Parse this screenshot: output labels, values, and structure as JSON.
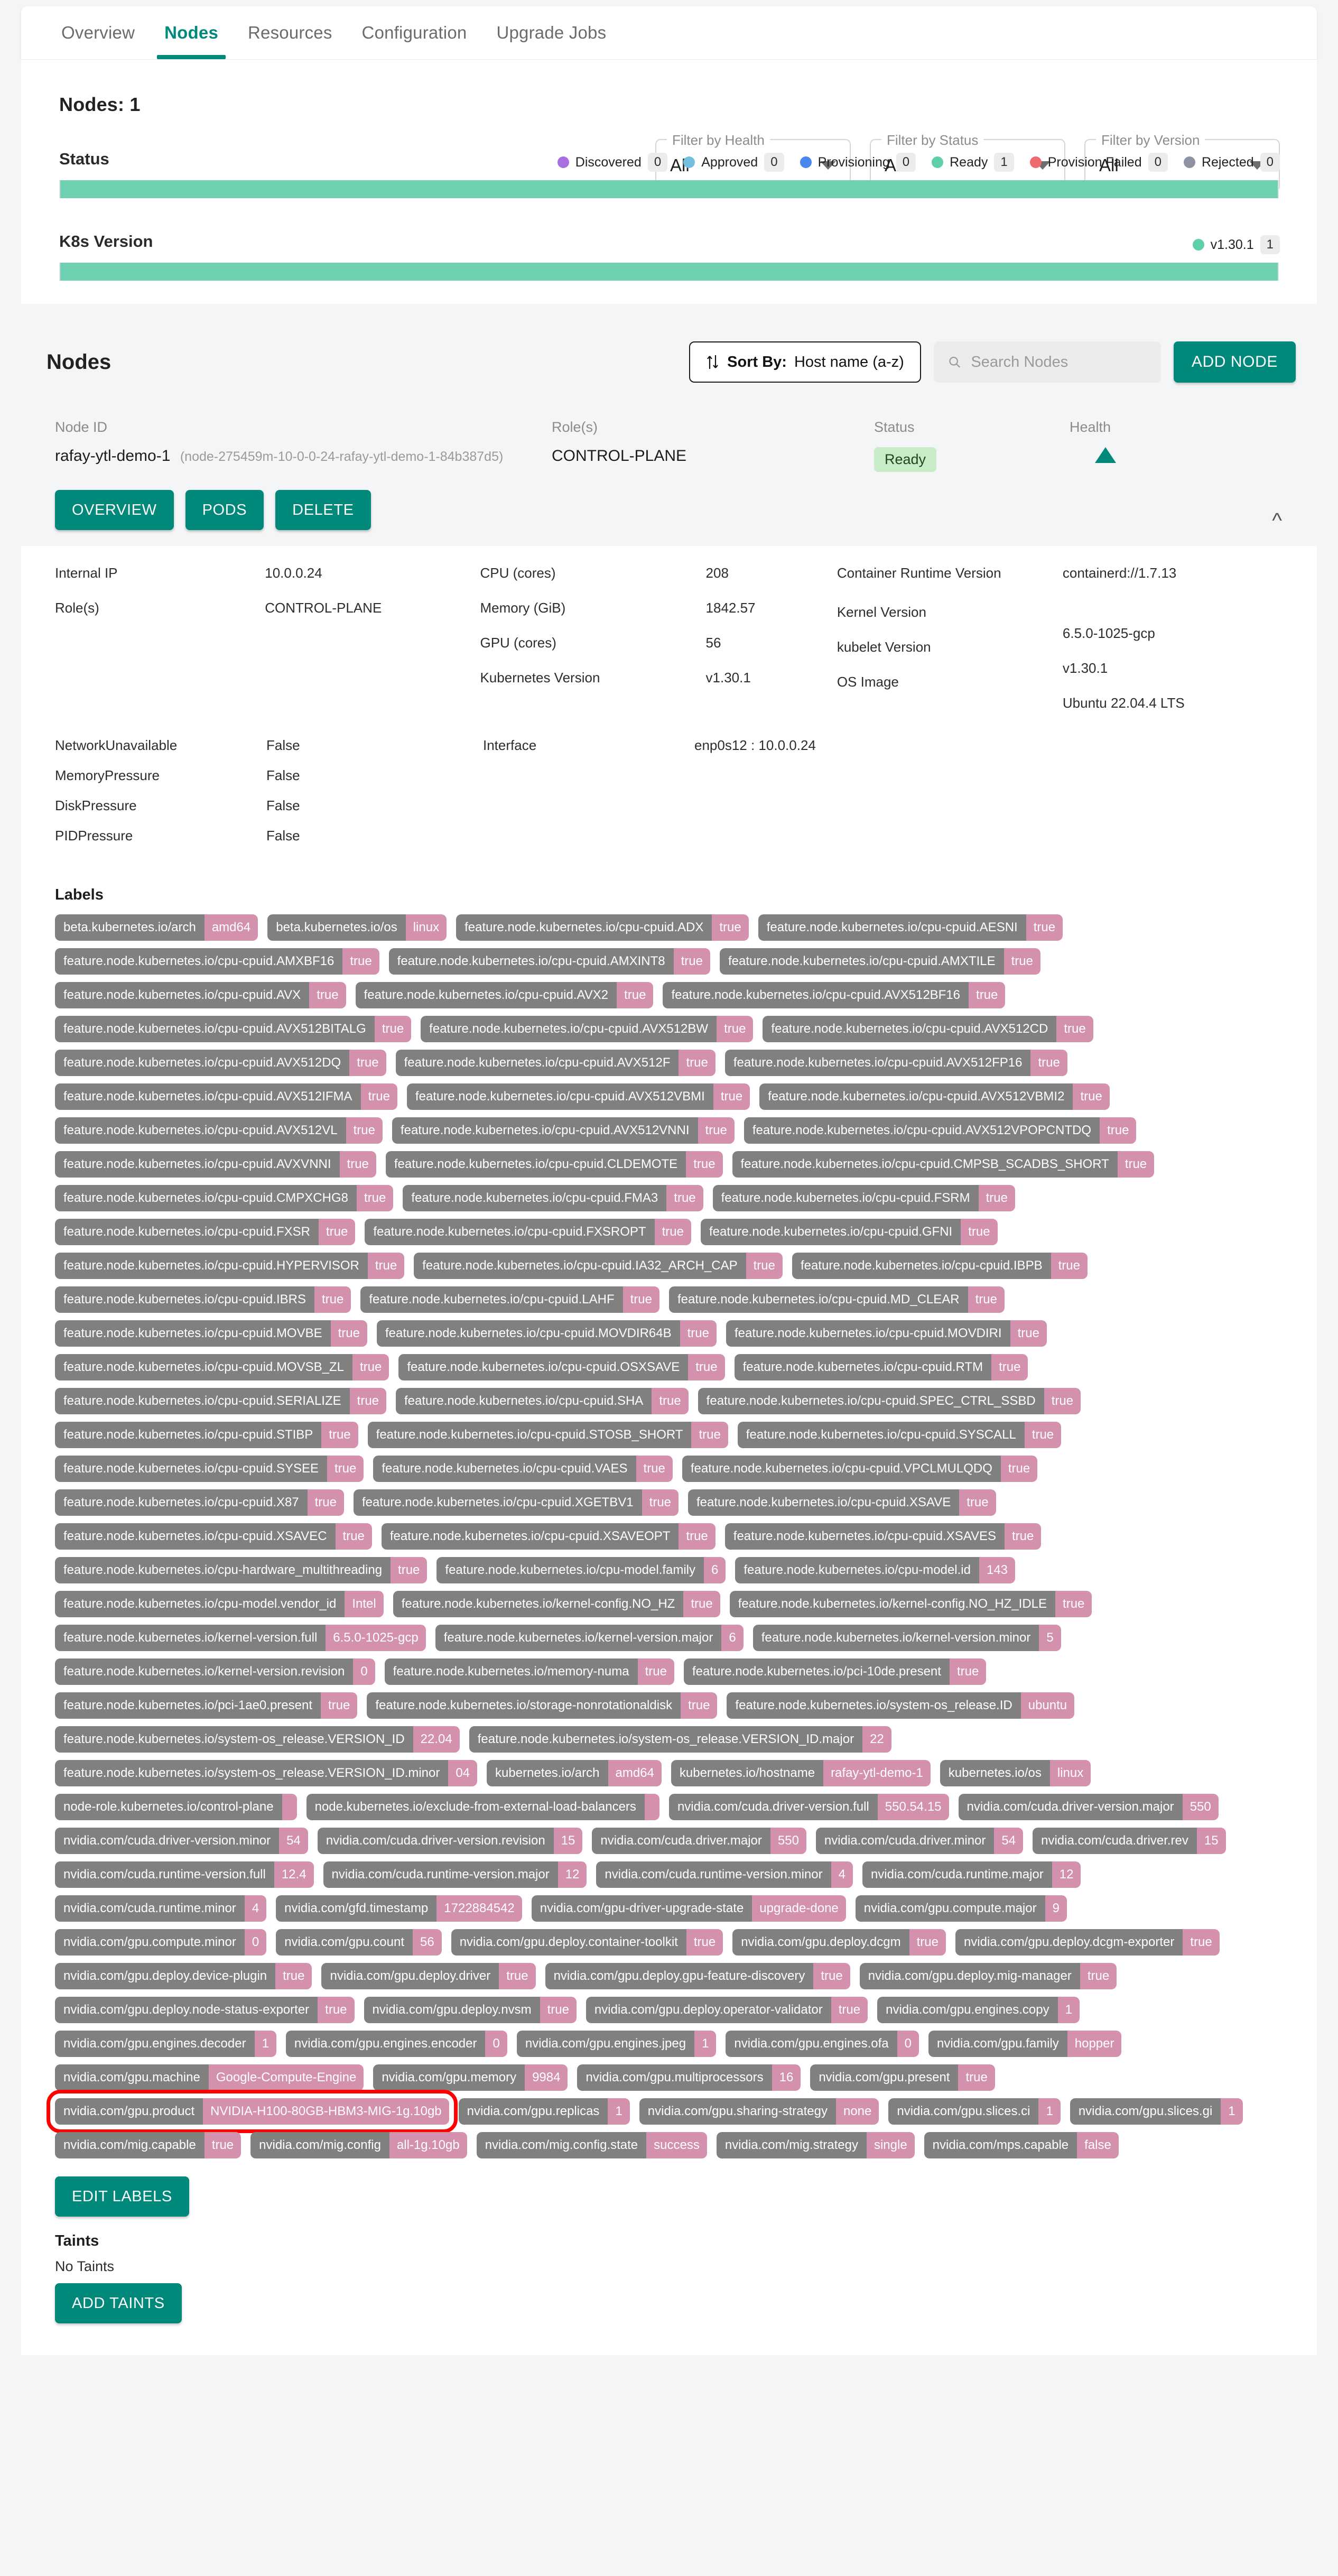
{
  "tabs": [
    {
      "label": "Overview",
      "active": false
    },
    {
      "label": "Nodes",
      "active": true
    },
    {
      "label": "Resources",
      "active": false
    },
    {
      "label": "Configuration",
      "active": false
    },
    {
      "label": "Upgrade Jobs",
      "active": false
    }
  ],
  "summary": {
    "nodes_count_label": "Nodes: 1",
    "filters": [
      {
        "legend": "Filter by Health",
        "value": "All"
      },
      {
        "legend": "Filter by Status",
        "value": "All"
      },
      {
        "legend": "Filter by Version",
        "value": "All"
      }
    ],
    "status": {
      "label": "Status",
      "legend": [
        {
          "name": "Discovered",
          "count": "0",
          "color": "#a96fe0"
        },
        {
          "name": "Approved",
          "count": "0",
          "color": "#74bede"
        },
        {
          "name": "Provisioning",
          "count": "0",
          "color": "#4a86ee"
        },
        {
          "name": "Ready",
          "count": "1",
          "color": "#5ecfa6"
        },
        {
          "name": "Provision Failed",
          "count": "0",
          "color": "#ef6b6b"
        },
        {
          "name": "Rejected",
          "count": "0",
          "color": "#8d93a3"
        }
      ],
      "bar_color": "#6ed0b0",
      "bar_percent": 100
    },
    "k8s_version": {
      "label": "K8s Version",
      "legend": [
        {
          "name": "v1.30.1",
          "count": "1",
          "color": "#5ecfa6"
        }
      ],
      "bar_color": "#6ed0b0",
      "bar_percent": 100
    }
  },
  "nodes_toolbar": {
    "title": "Nodes",
    "sort_icon": "sort-arrows-icon",
    "sort_prefix": "Sort By:",
    "sort_value": "Host name (a-z)",
    "search_icon": "search-icon",
    "search_placeholder": "Search Nodes",
    "search_value": "",
    "add_node_label": "ADD NODE"
  },
  "node": {
    "columns": {
      "node_id": "Node ID",
      "roles": "Role(s)",
      "status": "Status",
      "health": "Health"
    },
    "node_id_value": "rafay-ytl-demo-1",
    "node_id_sub": "(node-275459m-10-0-0-24-rafay-ytl-demo-1-84b387d5)",
    "roles_value": "CONTROL-PLANE",
    "status_value": "Ready",
    "health_icon": "triangle-up-icon",
    "collapse_icon": "chevron-up-icon",
    "actions": [
      {
        "label": "OVERVIEW"
      },
      {
        "label": "PODS"
      },
      {
        "label": "DELETE"
      }
    ],
    "info": {
      "col1": [
        {
          "key": "Internal IP",
          "value": "10.0.0.24"
        },
        {
          "key": "Role(s)",
          "value": "CONTROL-PLANE"
        }
      ],
      "col2": [
        {
          "key": "CPU (cores)",
          "value": "208"
        },
        {
          "key": "Memory (GiB)",
          "value": "1842.57"
        },
        {
          "key": "GPU (cores)",
          "value": "56"
        },
        {
          "key": "Kubernetes Version",
          "value": "v1.30.1"
        }
      ],
      "col3": [
        {
          "key": "Container Runtime Version",
          "value": "containerd://1.7.13"
        },
        {
          "key": "Kernel Version",
          "value": "6.5.0-1025-gcp"
        },
        {
          "key": "kubelet Version",
          "value": "v1.30.1"
        },
        {
          "key": "OS Image",
          "value": "Ubuntu 22.04.4 LTS"
        }
      ]
    },
    "conditions": [
      {
        "key": "NetworkUnavailable",
        "value": "False"
      },
      {
        "key": "MemoryPressure",
        "value": "False"
      },
      {
        "key": "DiskPressure",
        "value": "False"
      },
      {
        "key": "PIDPressure",
        "value": "False"
      }
    ],
    "interface": {
      "key": "Interface",
      "value": "enp0s12 : 10.0.0.24"
    }
  },
  "labels_section": {
    "title": "Labels",
    "edit_labels_label": "EDIT LABELS",
    "items": [
      {
        "k": "beta.kubernetes.io/arch",
        "v": "amd64"
      },
      {
        "k": "beta.kubernetes.io/os",
        "v": "linux"
      },
      {
        "k": "feature.node.kubernetes.io/cpu-cpuid.ADX",
        "v": "true"
      },
      {
        "k": "feature.node.kubernetes.io/cpu-cpuid.AESNI",
        "v": "true"
      },
      {
        "k": "feature.node.kubernetes.io/cpu-cpuid.AMXBF16",
        "v": "true"
      },
      {
        "k": "feature.node.kubernetes.io/cpu-cpuid.AMXINT8",
        "v": "true"
      },
      {
        "k": "feature.node.kubernetes.io/cpu-cpuid.AMXTILE",
        "v": "true"
      },
      {
        "k": "feature.node.kubernetes.io/cpu-cpuid.AVX",
        "v": "true"
      },
      {
        "k": "feature.node.kubernetes.io/cpu-cpuid.AVX2",
        "v": "true"
      },
      {
        "k": "feature.node.kubernetes.io/cpu-cpuid.AVX512BF16",
        "v": "true"
      },
      {
        "k": "feature.node.kubernetes.io/cpu-cpuid.AVX512BITALG",
        "v": "true"
      },
      {
        "k": "feature.node.kubernetes.io/cpu-cpuid.AVX512BW",
        "v": "true"
      },
      {
        "k": "feature.node.kubernetes.io/cpu-cpuid.AVX512CD",
        "v": "true"
      },
      {
        "k": "feature.node.kubernetes.io/cpu-cpuid.AVX512DQ",
        "v": "true"
      },
      {
        "k": "feature.node.kubernetes.io/cpu-cpuid.AVX512F",
        "v": "true"
      },
      {
        "k": "feature.node.kubernetes.io/cpu-cpuid.AVX512FP16",
        "v": "true"
      },
      {
        "k": "feature.node.kubernetes.io/cpu-cpuid.AVX512IFMA",
        "v": "true"
      },
      {
        "k": "feature.node.kubernetes.io/cpu-cpuid.AVX512VBMI",
        "v": "true"
      },
      {
        "k": "feature.node.kubernetes.io/cpu-cpuid.AVX512VBMI2",
        "v": "true"
      },
      {
        "k": "feature.node.kubernetes.io/cpu-cpuid.AVX512VL",
        "v": "true"
      },
      {
        "k": "feature.node.kubernetes.io/cpu-cpuid.AVX512VNNI",
        "v": "true"
      },
      {
        "k": "feature.node.kubernetes.io/cpu-cpuid.AVX512VPOPCNTDQ",
        "v": "true"
      },
      {
        "k": "feature.node.kubernetes.io/cpu-cpuid.AVXVNNI",
        "v": "true"
      },
      {
        "k": "feature.node.kubernetes.io/cpu-cpuid.CLDEMOTE",
        "v": "true"
      },
      {
        "k": "feature.node.kubernetes.io/cpu-cpuid.CMPSB_SCADBS_SHORT",
        "v": "true"
      },
      {
        "k": "feature.node.kubernetes.io/cpu-cpuid.CMPXCHG8",
        "v": "true"
      },
      {
        "k": "feature.node.kubernetes.io/cpu-cpuid.FMA3",
        "v": "true"
      },
      {
        "k": "feature.node.kubernetes.io/cpu-cpuid.FSRM",
        "v": "true"
      },
      {
        "k": "feature.node.kubernetes.io/cpu-cpuid.FXSR",
        "v": "true"
      },
      {
        "k": "feature.node.kubernetes.io/cpu-cpuid.FXSROPT",
        "v": "true"
      },
      {
        "k": "feature.node.kubernetes.io/cpu-cpuid.GFNI",
        "v": "true"
      },
      {
        "k": "feature.node.kubernetes.io/cpu-cpuid.HYPERVISOR",
        "v": "true"
      },
      {
        "k": "feature.node.kubernetes.io/cpu-cpuid.IA32_ARCH_CAP",
        "v": "true"
      },
      {
        "k": "feature.node.kubernetes.io/cpu-cpuid.IBPB",
        "v": "true"
      },
      {
        "k": "feature.node.kubernetes.io/cpu-cpuid.IBRS",
        "v": "true"
      },
      {
        "k": "feature.node.kubernetes.io/cpu-cpuid.LAHF",
        "v": "true"
      },
      {
        "k": "feature.node.kubernetes.io/cpu-cpuid.MD_CLEAR",
        "v": "true"
      },
      {
        "k": "feature.node.kubernetes.io/cpu-cpuid.MOVBE",
        "v": "true"
      },
      {
        "k": "feature.node.kubernetes.io/cpu-cpuid.MOVDIR64B",
        "v": "true"
      },
      {
        "k": "feature.node.kubernetes.io/cpu-cpuid.MOVDIRI",
        "v": "true"
      },
      {
        "k": "feature.node.kubernetes.io/cpu-cpuid.MOVSB_ZL",
        "v": "true"
      },
      {
        "k": "feature.node.kubernetes.io/cpu-cpuid.OSXSAVE",
        "v": "true"
      },
      {
        "k": "feature.node.kubernetes.io/cpu-cpuid.RTM",
        "v": "true"
      },
      {
        "k": "feature.node.kubernetes.io/cpu-cpuid.SERIALIZE",
        "v": "true"
      },
      {
        "k": "feature.node.kubernetes.io/cpu-cpuid.SHA",
        "v": "true"
      },
      {
        "k": "feature.node.kubernetes.io/cpu-cpuid.SPEC_CTRL_SSBD",
        "v": "true"
      },
      {
        "k": "feature.node.kubernetes.io/cpu-cpuid.STIBP",
        "v": "true"
      },
      {
        "k": "feature.node.kubernetes.io/cpu-cpuid.STOSB_SHORT",
        "v": "true"
      },
      {
        "k": "feature.node.kubernetes.io/cpu-cpuid.SYSCALL",
        "v": "true"
      },
      {
        "k": "feature.node.kubernetes.io/cpu-cpuid.SYSEE",
        "v": "true"
      },
      {
        "k": "feature.node.kubernetes.io/cpu-cpuid.VAES",
        "v": "true"
      },
      {
        "k": "feature.node.kubernetes.io/cpu-cpuid.VPCLMULQDQ",
        "v": "true"
      },
      {
        "k": "feature.node.kubernetes.io/cpu-cpuid.X87",
        "v": "true"
      },
      {
        "k": "feature.node.kubernetes.io/cpu-cpuid.XGETBV1",
        "v": "true"
      },
      {
        "k": "feature.node.kubernetes.io/cpu-cpuid.XSAVE",
        "v": "true"
      },
      {
        "k": "feature.node.kubernetes.io/cpu-cpuid.XSAVEC",
        "v": "true"
      },
      {
        "k": "feature.node.kubernetes.io/cpu-cpuid.XSAVEOPT",
        "v": "true"
      },
      {
        "k": "feature.node.kubernetes.io/cpu-cpuid.XSAVES",
        "v": "true"
      },
      {
        "k": "feature.node.kubernetes.io/cpu-hardware_multithreading",
        "v": "true"
      },
      {
        "k": "feature.node.kubernetes.io/cpu-model.family",
        "v": "6"
      },
      {
        "k": "feature.node.kubernetes.io/cpu-model.id",
        "v": "143"
      },
      {
        "k": "feature.node.kubernetes.io/cpu-model.vendor_id",
        "v": "Intel"
      },
      {
        "k": "feature.node.kubernetes.io/kernel-config.NO_HZ",
        "v": "true"
      },
      {
        "k": "feature.node.kubernetes.io/kernel-config.NO_HZ_IDLE",
        "v": "true"
      },
      {
        "k": "feature.node.kubernetes.io/kernel-version.full",
        "v": "6.5.0-1025-gcp"
      },
      {
        "k": "feature.node.kubernetes.io/kernel-version.major",
        "v": "6"
      },
      {
        "k": "feature.node.kubernetes.io/kernel-version.minor",
        "v": "5"
      },
      {
        "k": "feature.node.kubernetes.io/kernel-version.revision",
        "v": "0"
      },
      {
        "k": "feature.node.kubernetes.io/memory-numa",
        "v": "true"
      },
      {
        "k": "feature.node.kubernetes.io/pci-10de.present",
        "v": "true"
      },
      {
        "k": "feature.node.kubernetes.io/pci-1ae0.present",
        "v": "true"
      },
      {
        "k": "feature.node.kubernetes.io/storage-nonrotationaldisk",
        "v": "true"
      },
      {
        "k": "feature.node.kubernetes.io/system-os_release.ID",
        "v": "ubuntu"
      },
      {
        "k": "feature.node.kubernetes.io/system-os_release.VERSION_ID",
        "v": "22.04"
      },
      {
        "k": "feature.node.kubernetes.io/system-os_release.VERSION_ID.major",
        "v": "22"
      },
      {
        "k": "feature.node.kubernetes.io/system-os_release.VERSION_ID.minor",
        "v": "04"
      },
      {
        "k": "kubernetes.io/arch",
        "v": "amd64"
      },
      {
        "k": "kubernetes.io/hostname",
        "v": "rafay-ytl-demo-1"
      },
      {
        "k": "kubernetes.io/os",
        "v": "linux"
      },
      {
        "k": "node-role.kubernetes.io/control-plane",
        "v": ""
      },
      {
        "k": "node.kubernetes.io/exclude-from-external-load-balancers",
        "v": ""
      },
      {
        "k": "nvidia.com/cuda.driver-version.full",
        "v": "550.54.15"
      },
      {
        "k": "nvidia.com/cuda.driver-version.major",
        "v": "550"
      },
      {
        "k": "nvidia.com/cuda.driver-version.minor",
        "v": "54"
      },
      {
        "k": "nvidia.com/cuda.driver-version.revision",
        "v": "15"
      },
      {
        "k": "nvidia.com/cuda.driver.major",
        "v": "550"
      },
      {
        "k": "nvidia.com/cuda.driver.minor",
        "v": "54"
      },
      {
        "k": "nvidia.com/cuda.driver.rev",
        "v": "15"
      },
      {
        "k": "nvidia.com/cuda.runtime-version.full",
        "v": "12.4"
      },
      {
        "k": "nvidia.com/cuda.runtime-version.major",
        "v": "12"
      },
      {
        "k": "nvidia.com/cuda.runtime-version.minor",
        "v": "4"
      },
      {
        "k": "nvidia.com/cuda.runtime.major",
        "v": "12"
      },
      {
        "k": "nvidia.com/cuda.runtime.minor",
        "v": "4"
      },
      {
        "k": "nvidia.com/gfd.timestamp",
        "v": "1722884542"
      },
      {
        "k": "nvidia.com/gpu-driver-upgrade-state",
        "v": "upgrade-done"
      },
      {
        "k": "nvidia.com/gpu.compute.major",
        "v": "9"
      },
      {
        "k": "nvidia.com/gpu.compute.minor",
        "v": "0"
      },
      {
        "k": "nvidia.com/gpu.count",
        "v": "56"
      },
      {
        "k": "nvidia.com/gpu.deploy.container-toolkit",
        "v": "true"
      },
      {
        "k": "nvidia.com/gpu.deploy.dcgm",
        "v": "true"
      },
      {
        "k": "nvidia.com/gpu.deploy.dcgm-exporter",
        "v": "true"
      },
      {
        "k": "nvidia.com/gpu.deploy.device-plugin",
        "v": "true"
      },
      {
        "k": "nvidia.com/gpu.deploy.driver",
        "v": "true"
      },
      {
        "k": "nvidia.com/gpu.deploy.gpu-feature-discovery",
        "v": "true"
      },
      {
        "k": "nvidia.com/gpu.deploy.mig-manager",
        "v": "true"
      },
      {
        "k": "nvidia.com/gpu.deploy.node-status-exporter",
        "v": "true"
      },
      {
        "k": "nvidia.com/gpu.deploy.nvsm",
        "v": "true"
      },
      {
        "k": "nvidia.com/gpu.deploy.operator-validator",
        "v": "true"
      },
      {
        "k": "nvidia.com/gpu.engines.copy",
        "v": "1"
      },
      {
        "k": "nvidia.com/gpu.engines.decoder",
        "v": "1"
      },
      {
        "k": "nvidia.com/gpu.engines.encoder",
        "v": "0"
      },
      {
        "k": "nvidia.com/gpu.engines.jpeg",
        "v": "1"
      },
      {
        "k": "nvidia.com/gpu.engines.ofa",
        "v": "0"
      },
      {
        "k": "nvidia.com/gpu.family",
        "v": "hopper"
      },
      {
        "k": "nvidia.com/gpu.machine",
        "v": "Google-Compute-Engine"
      },
      {
        "k": "nvidia.com/gpu.memory",
        "v": "9984"
      },
      {
        "k": "nvidia.com/gpu.multiprocessors",
        "v": "16"
      },
      {
        "k": "nvidia.com/gpu.present",
        "v": "true"
      },
      {
        "k": "nvidia.com/gpu.product",
        "v": "NVIDIA-H100-80GB-HBM3-MIG-1g.10gb",
        "highlight": true
      },
      {
        "k": "nvidia.com/gpu.replicas",
        "v": "1"
      },
      {
        "k": "nvidia.com/gpu.sharing-strategy",
        "v": "none"
      },
      {
        "k": "nvidia.com/gpu.slices.ci",
        "v": "1"
      },
      {
        "k": "nvidia.com/gpu.slices.gi",
        "v": "1"
      },
      {
        "k": "nvidia.com/mig.capable",
        "v": "true"
      },
      {
        "k": "nvidia.com/mig.config",
        "v": "all-1g.10gb"
      },
      {
        "k": "nvidia.com/mig.config.state",
        "v": "success"
      },
      {
        "k": "nvidia.com/mig.strategy",
        "v": "single"
      },
      {
        "k": "nvidia.com/mps.capable",
        "v": "false"
      }
    ]
  },
  "taints_section": {
    "title": "Taints",
    "empty_text": "No Taints",
    "add_taints_label": "ADD TAINTS"
  },
  "colors": {
    "accent": "#00897a",
    "chip_key": "#808080",
    "chip_value": "#d491ad",
    "highlight": "#ff0000",
    "bar": "#6ed0b0",
    "ready_chip_bg": "#c8ebc8"
  }
}
